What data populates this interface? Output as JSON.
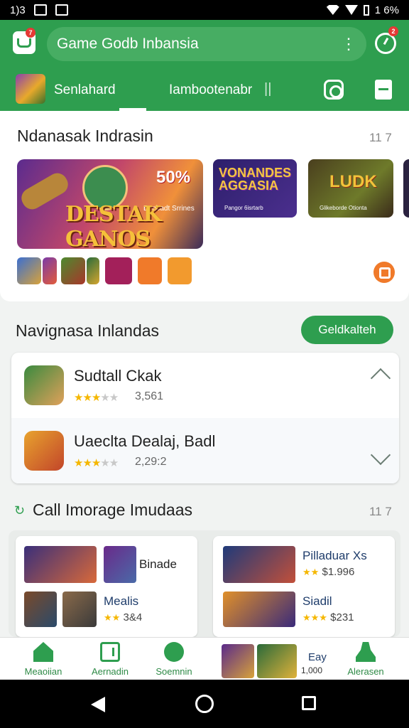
{
  "status_bar": {
    "left_text": "1)3",
    "battery_text": "1 6%"
  },
  "search": {
    "query": "Game Godb Inbansia",
    "menu_glyph": "⋮",
    "badge_count": "7",
    "timer_badge_count": "2"
  },
  "tabs": [
    {
      "label": "Senlahard"
    },
    {
      "label": "Iambootenabr"
    }
  ],
  "tab_separator": "||",
  "featured": {
    "title": "Ndanasak Indrasin",
    "count": "11 7",
    "banner_main": {
      "title": "DESTAK GANOS",
      "discount": "50%",
      "subtitle": "Benbadt Srrines"
    },
    "banner_2": {
      "title": "VONANDES AGGASIA",
      "subtitle": "Pangor 6isrtarb"
    },
    "banner_3": {
      "title": "LUDK",
      "subtitle": "Glikeborde Otionta"
    }
  },
  "popular": {
    "title": "Navignasa Inlandas",
    "button_label": "Geldkalteh",
    "items": [
      {
        "name": "Sudtall Ckak",
        "stars": "★★★",
        "stars_dim": "★★",
        "rating": "3,561"
      },
      {
        "name": "Uaeclta Dealaj, Badl",
        "stars": "★★★",
        "stars_dim": "★★",
        "rating": "2,29:2"
      }
    ]
  },
  "collection": {
    "title": "Call Imorage Imudaas",
    "count": "11 7",
    "left_card": [
      {
        "label": "Binade",
        "price": ""
      },
      {
        "label": "Mealis",
        "price": "3&4"
      }
    ],
    "right_card": [
      {
        "label": "Pilladuar Xs",
        "price": "$1.996"
      },
      {
        "label": "Siadil",
        "price": "$231"
      }
    ]
  },
  "bottom_nav": [
    {
      "label": "Meaoiian"
    },
    {
      "label": "Aernadin"
    },
    {
      "label": "Soemnin"
    },
    {
      "label": "Alerasen"
    }
  ],
  "promo": {
    "label": "Eay",
    "sub": "1,000"
  },
  "colors": {
    "brand_green": "#2e9e4f",
    "accent_orange": "#f07a2a",
    "star": "#f5b700"
  }
}
